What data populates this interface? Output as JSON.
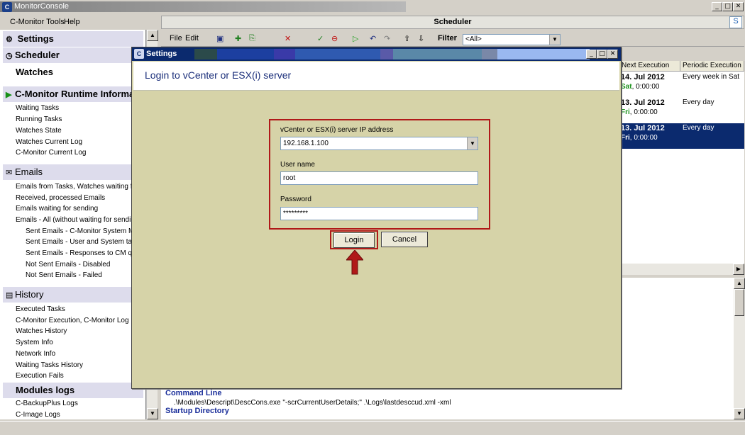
{
  "window": {
    "title": "MonitorConsole",
    "min": "_",
    "max": "□",
    "close": "✕"
  },
  "menu": {
    "tools": "C-Monitor Tools",
    "help": "Help"
  },
  "sidebar": {
    "settings": "Settings",
    "scheduler": "Scheduler",
    "watches": "Watches",
    "runtime": "C-Monitor Runtime Informat",
    "runtime_items": [
      "Waiting Tasks",
      "Running Tasks",
      "Watches State",
      "Watches Current Log",
      "C-Monitor Current Log"
    ],
    "emails": "Emails",
    "email_items": [
      "Emails from Tasks, Watches waiting for",
      "Received, processed Emails",
      "Emails waiting for sending",
      "Emails - All (without waiting for sending)"
    ],
    "email_subitems": [
      "Sent Emails - C-Monitor System Mes",
      "Sent Emails - User and System task",
      "Sent Emails - Responses to CM que",
      "Not Sent Emails - Disabled",
      "Not Sent Emails - Failed"
    ],
    "history": "History",
    "history_items": [
      "Executed Tasks",
      "C-Monitor Execution, C-Monitor Log His",
      "Watches History",
      "System Info",
      "Network Info",
      "Waiting Tasks History",
      "Execution Fails"
    ],
    "modules": "Modules logs",
    "module_items": [
      "C-BackupPlus Logs",
      "C-Image Logs"
    ]
  },
  "scheduler": {
    "header": "Scheduler",
    "toolbar_file": "File",
    "toolbar_edit": "Edit",
    "filter_label": "Filter",
    "filter_value": "<All>",
    "columns": [
      "Next Execution",
      "Periodic Execution"
    ],
    "rows": [
      {
        "date": "14. Jul 2012",
        "day": "Sat",
        "time": ", 0:00:00",
        "periodic": "Every week in Sat"
      },
      {
        "date": "13. Jul 2012",
        "day": "Fri",
        "time": ", 0:00:00",
        "periodic": "Every day"
      },
      {
        "date": "13. Jul 2012",
        "day": "Fri",
        "time": ", 0:00:00",
        "periodic": "Every day"
      }
    ],
    "details": {
      "cmd_label": "Command Line",
      "cmd_value": ".\\Modules\\Descript\\DescCons.exe \"-scrCurrentUserDetails;\" .\\Logs\\lastdesccud.xml -xml",
      "startup_label": "Startup Directory"
    }
  },
  "dialog": {
    "title": "Settings",
    "heading": "Login to vCenter or ESX(i) server",
    "ip_label": "vCenter or ESX(i) server IP address",
    "ip_value": "192.168.1.100",
    "user_label": "User name",
    "user_value": "root",
    "pass_label": "Password",
    "pass_value": "*********",
    "login": "Login",
    "cancel": "Cancel"
  },
  "colors": {
    "accent": "#0b2a6e",
    "highlight": "#b01818",
    "dialog_bg": "#d6d3a8",
    "selected_row": "#0b2a6e"
  }
}
